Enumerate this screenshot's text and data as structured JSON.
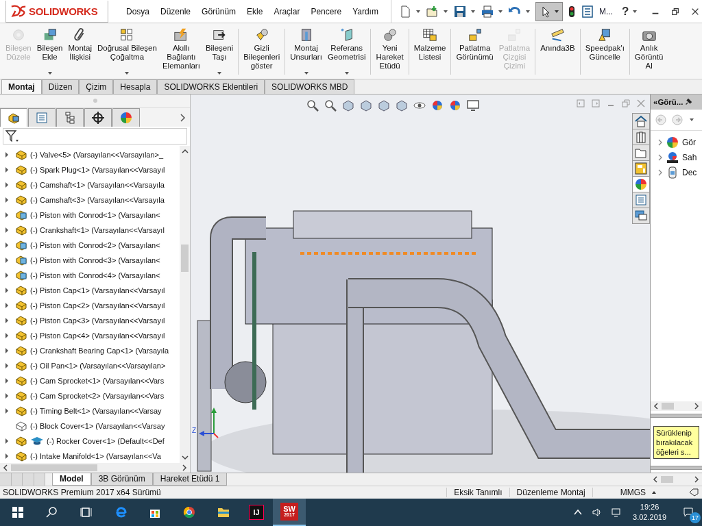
{
  "app": {
    "logo": "SOLIDWORKS"
  },
  "menu": [
    "Dosya",
    "Düzenle",
    "Görünüm",
    "Ekle",
    "Araçlar",
    "Pencere",
    "Yardım"
  ],
  "quick_toolbar": {
    "select_pressed": true,
    "options_label": "M...",
    "help_label": "?"
  },
  "ribbon": [
    [
      {
        "label": "Bileşen\nDüzele",
        "disabled": true,
        "dropdown": false
      },
      {
        "label": "Bileşen\nEkle",
        "disabled": false,
        "dropdown": true
      },
      {
        "label": "Montaj\nİlişkisi",
        "disabled": false,
        "dropdown": false
      },
      {
        "label": "Doğrusal Bileşen\nÇoğaltma",
        "disabled": false,
        "dropdown": true
      },
      {
        "label": "Akıllı\nBağlantı\nElemanları",
        "disabled": false,
        "dropdown": false
      },
      {
        "label": "Bileşeni\nTaşı",
        "disabled": false,
        "dropdown": true
      }
    ],
    [
      {
        "label": "Gizli\nBileşenleri\ngöster",
        "disabled": false,
        "dropdown": false
      }
    ],
    [
      {
        "label": "Montaj\nUnsurları",
        "disabled": false,
        "dropdown": true
      },
      {
        "label": "Referans\nGeometrisi",
        "disabled": false,
        "dropdown": true
      }
    ],
    [
      {
        "label": "Yeni\nHareket\nEtüdü",
        "disabled": false,
        "dropdown": false
      }
    ],
    [
      {
        "label": "Malzeme\nListesi",
        "disabled": false,
        "dropdown": false
      }
    ],
    [
      {
        "label": "Patlatma\nGörünümü",
        "disabled": false,
        "dropdown": false
      },
      {
        "label": "Patlatma\nÇizgisi\nÇizimi",
        "disabled": true,
        "dropdown": false
      }
    ],
    [
      {
        "label": "Anında3B",
        "disabled": false,
        "dropdown": false
      }
    ],
    [
      {
        "label": "Speedpak'ı\nGüncelle",
        "disabled": false,
        "dropdown": false
      }
    ],
    [
      {
        "label": "Anlık\nGörüntü\nAl",
        "disabled": false,
        "dropdown": false
      }
    ]
  ],
  "command_tabs": [
    {
      "label": "Montaj",
      "selected": true
    },
    {
      "label": "Düzen",
      "selected": false
    },
    {
      "label": "Çizim",
      "selected": false
    },
    {
      "label": "Hesapla",
      "selected": false
    },
    {
      "label": "SOLIDWORKS Eklentileri",
      "selected": false
    },
    {
      "label": "SOLIDWORKS MBD",
      "selected": false
    }
  ],
  "panel_tabs": [
    {
      "selected": true
    },
    {
      "selected": false
    },
    {
      "selected": false
    },
    {
      "selected": false
    },
    {
      "selected": false
    }
  ],
  "tree": [
    {
      "label": "(-) Valve<5> (Varsayılan<<Varsayılan>_",
      "kind": "part",
      "expandable": true,
      "tagged": false
    },
    {
      "label": "(-) Spark Plug<1> (Varsayılan<<Varsayıl",
      "kind": "part",
      "expandable": true,
      "tagged": false
    },
    {
      "label": "(-) Camshaft<1> (Varsayılan<<Varsayıla",
      "kind": "part",
      "expandable": true,
      "tagged": false
    },
    {
      "label": "(-) Camshaft<3> (Varsayılan<<Varsayıla",
      "kind": "part",
      "expandable": true,
      "tagged": false
    },
    {
      "label": "(-) Piston with Conrod<1> (Varsayılan<",
      "kind": "assembly",
      "expandable": true,
      "tagged": false
    },
    {
      "label": "(-) Crankshaft<1> (Varsayılan<<Varsayıl",
      "kind": "part",
      "expandable": true,
      "tagged": false
    },
    {
      "label": "(-) Piston with Conrod<2> (Varsayılan<",
      "kind": "assembly",
      "expandable": true,
      "tagged": false
    },
    {
      "label": "(-) Piston with Conrod<3> (Varsayılan<",
      "kind": "assembly",
      "expandable": true,
      "tagged": false
    },
    {
      "label": "(-) Piston with Conrod<4> (Varsayılan<",
      "kind": "assembly",
      "expandable": true,
      "tagged": false
    },
    {
      "label": "(-) Piston Cap<1> (Varsayılan<<Varsayıl",
      "kind": "part",
      "expandable": true,
      "tagged": false
    },
    {
      "label": "(-) Piston Cap<2> (Varsayılan<<Varsayıl",
      "kind": "part",
      "expandable": true,
      "tagged": false
    },
    {
      "label": "(-) Piston Cap<3> (Varsayılan<<Varsayıl",
      "kind": "part",
      "expandable": true,
      "tagged": false
    },
    {
      "label": "(-) Piston Cap<4> (Varsayılan<<Varsayıl",
      "kind": "part",
      "expandable": true,
      "tagged": false
    },
    {
      "label": "(-) Crankshaft Bearing Cap<1> (Varsayıla",
      "kind": "part",
      "expandable": true,
      "tagged": false
    },
    {
      "label": "(-) Oil Pan<1> (Varsayılan<<Varsayılan>",
      "kind": "part",
      "expandable": true,
      "tagged": false
    },
    {
      "label": "(-) Cam Sprocket<1> (Varsayılan<<Vars",
      "kind": "part",
      "expandable": true,
      "tagged": false
    },
    {
      "label": "(-) Cam Sprocket<2> (Varsayılan<<Vars",
      "kind": "part",
      "expandable": true,
      "tagged": false
    },
    {
      "label": "(-) Timing Belt<1> (Varsayılan<<Varsay",
      "kind": "part",
      "expandable": true,
      "tagged": false
    },
    {
      "label": "(-) Block Cover<1> (Varsayılan<<Varsay",
      "kind": "outline",
      "expandable": false,
      "tagged": false
    },
    {
      "label": "(-) Rocker Cover<1> (Default<<Def",
      "kind": "part",
      "expandable": true,
      "tagged": true
    },
    {
      "label": "(-) Intake Manifold<1> (Varsayılan<<Va",
      "kind": "part",
      "expandable": true,
      "tagged": false
    }
  ],
  "viewport": {
    "triad_label": "Z"
  },
  "task_pane": {
    "title": "«Görü...",
    "items": [
      "Gör",
      "Sah",
      "Dec"
    ],
    "note": "Sürüklenip bırakılacak öğeleri s...",
    "tabs": [
      {
        "selected": false
      },
      {
        "selected": false
      },
      {
        "selected": false
      },
      {
        "selected": false
      },
      {
        "selected": true
      },
      {
        "selected": false
      },
      {
        "selected": false
      }
    ]
  },
  "bottom_tabs": [
    {
      "label": "Model",
      "selected": true
    },
    {
      "label": "3B Görünüm",
      "selected": false
    },
    {
      "label": "Hareket Etüdü 1",
      "selected": false
    }
  ],
  "status_bar": {
    "version": "SOLIDWORKS Premium 2017 x64 Sürümü",
    "state": "Eksik Tanımlı",
    "mode": "Düzenleme Montaj",
    "units": "MMGS"
  },
  "taskbar": {
    "apps": [
      {
        "label": "IJ",
        "selected": false
      },
      {
        "label": "SW",
        "sub": "2017",
        "selected": true
      }
    ],
    "time": "19:26",
    "date": "3.02.2019",
    "notifications": "17"
  }
}
